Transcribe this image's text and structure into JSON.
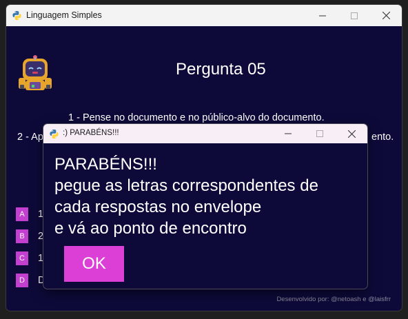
{
  "window": {
    "title": "Linguagem Simples"
  },
  "question": {
    "title": "Pergunta 05",
    "instruction_1": "1 - Pense no documento e no público-alvo do documento.",
    "instruction_2_start": "2 - Ap",
    "instruction_2_end": "ento."
  },
  "options": [
    {
      "letter": "A",
      "text": "1"
    },
    {
      "letter": "B",
      "text": "2"
    },
    {
      "letter": "C",
      "text": "1"
    },
    {
      "letter": "D",
      "text": "D"
    }
  ],
  "footer": "Desenvolvido por: @netoash e @laisfrr",
  "dialog": {
    "title": ":) PARABÉNS!!!",
    "message_lines": [
      "PARABÉNS!!!",
      "pegue as letras correspondentes de",
      "cada respostas no envelope",
      "e vá ao ponto de encontro"
    ],
    "ok_label": "OK"
  },
  "colors": {
    "background": "#0d0a3a",
    "option_box": "#c33fcf",
    "ok_button": "#dc3fd6"
  }
}
